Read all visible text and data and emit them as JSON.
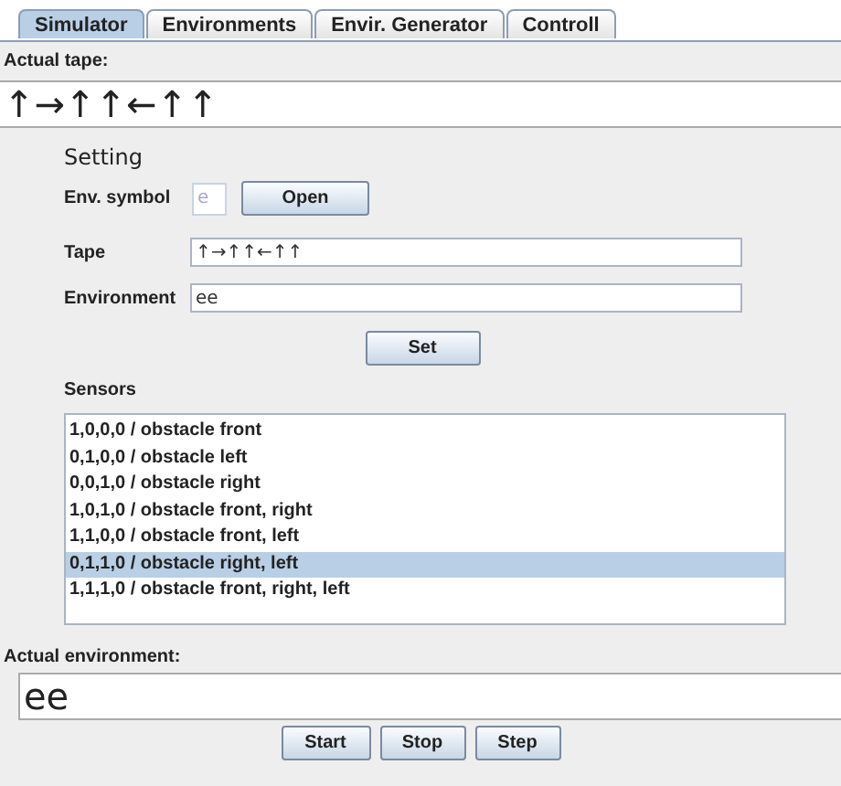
{
  "tabs": [
    {
      "label": "Simulator",
      "selected": true
    },
    {
      "label": "Environments",
      "selected": false
    },
    {
      "label": "Envir. Generator",
      "selected": false
    },
    {
      "label": "Controll",
      "selected": false
    }
  ],
  "actual_tape": {
    "label": "Actual tape:",
    "value": "↑→↑↑←↑↑"
  },
  "setting": {
    "title": "Setting",
    "env_symbol": {
      "label": "Env. symbol",
      "value": "e",
      "disabled": true
    },
    "open_button": "Open",
    "tape": {
      "label": "Tape",
      "value": "↑→↑↑←↑↑"
    },
    "environment": {
      "label": "Environment",
      "value": "ee"
    },
    "set_button": "Set"
  },
  "sensors": {
    "label": "Sensors",
    "items": [
      {
        "text": "1,0,0,0 / obstacle front",
        "selected": false
      },
      {
        "text": "0,1,0,0 / obstacle left",
        "selected": false
      },
      {
        "text": "0,0,1,0 / obstacle right",
        "selected": false
      },
      {
        "text": "1,0,1,0 / obstacle front, right",
        "selected": false
      },
      {
        "text": "1,1,0,0 / obstacle front, left",
        "selected": false
      },
      {
        "text": "0,1,1,0 / obstacle right, left",
        "selected": true
      },
      {
        "text": "1,1,1,0 / obstacle front, right, left",
        "selected": false
      }
    ]
  },
  "actual_environment": {
    "label": "Actual environment:",
    "value": "ee"
  },
  "buttons": [
    "Start",
    "Stop",
    "Step"
  ]
}
